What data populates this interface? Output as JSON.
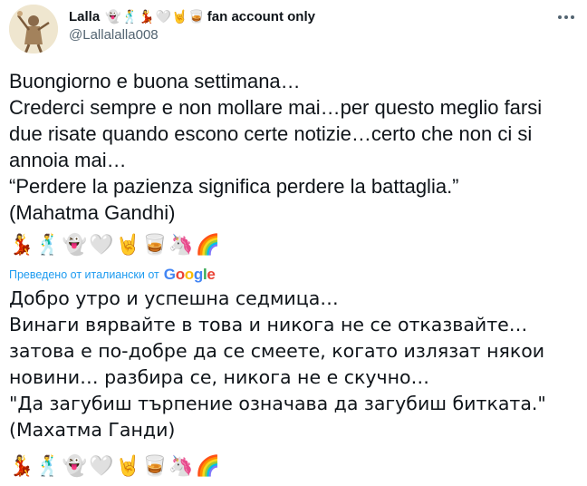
{
  "author": {
    "display_name": "Lalla",
    "name_emojis": "👻🕺💃🤍🤘🥃",
    "name_suffix": "fan account only",
    "handle": "@Lallalalla008"
  },
  "tweet": {
    "original_text": "Buongiorno e buona settimana…\nCrederci sempre e non mollare mai…per questo meglio farsi due risate quando escono certe notizie…certo che non ci si annoia mai…\n“Perdere la pazienza significa perdere la battaglia.”\n(Mahatma Gandhi)",
    "original_emojis": "💃🕺👻🤍🤘🥃🦄🌈",
    "translation_note": "Преведено от италиански от",
    "translation_provider": "Google",
    "translated_text": "Добро утро и успешна седмица…\nВинаги вярвайте в това и никога не се отказвайте… затова е по-добре да се смеете, когато излязат някои новини… разбира се, никога не е скучно…\n\"Да загубиш търпение означава да загубиш битката.\"\n(Махатма Ганди)",
    "translated_emojis": "💃🕺👻🤍🤘🥃🦄🌈"
  },
  "icons": {
    "more": "more-horizontal-icon",
    "avatar": "avatar-image"
  },
  "colors": {
    "text": "#0f1419",
    "secondary": "#536471",
    "link": "#1d9bf0",
    "google_blue": "#4285f4",
    "google_red": "#ea4335",
    "google_yellow": "#fbbc05",
    "google_green": "#34a853"
  }
}
